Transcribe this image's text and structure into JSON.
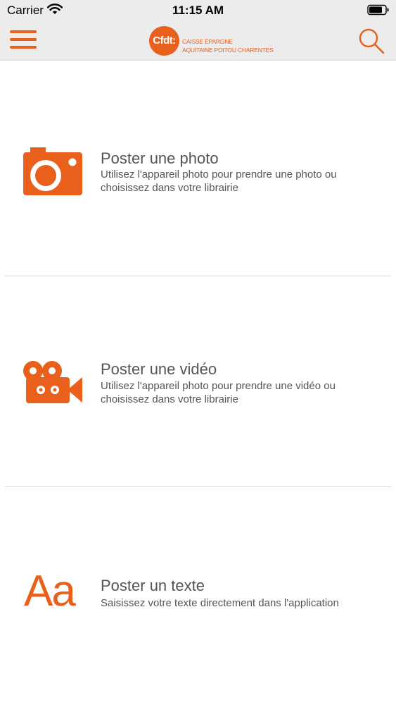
{
  "status_bar": {
    "carrier": "Carrier",
    "time": "11:15 AM",
    "icons": [
      "wifi-icon",
      "battery-icon"
    ]
  },
  "header": {
    "logo": {
      "mark": "Cfdt:",
      "line1": "CAISSE ÉPARGNE",
      "line2": "AQUITAINE POITOU CHARENTES"
    },
    "icons": [
      "hamburger-menu-icon",
      "search-icon"
    ],
    "accent_color": "#e8601c"
  },
  "options": [
    {
      "icon": "camera-icon",
      "title": "Poster une photo",
      "description": "Utilisez l'appareil photo pour prendre une photo ou choisissez dans votre librairie"
    },
    {
      "icon": "video-camera-icon",
      "title": "Poster une vidéo",
      "description": "Utilisez l'appareil photo pour prendre une vidéo ou choisissez dans votre librairie"
    },
    {
      "icon": "text-icon",
      "glyph": "Aa",
      "title": "Poster un texte",
      "description": "Saisissez votre texte directement dans l'application"
    }
  ]
}
